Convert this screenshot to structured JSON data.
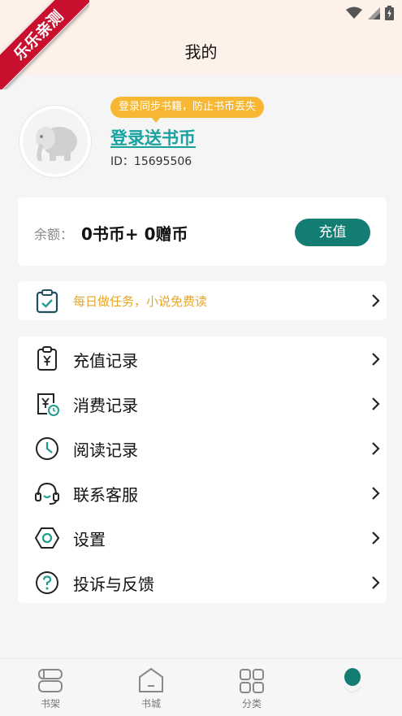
{
  "watermark": "乐乐亲测",
  "status_bar": {
    "icons": [
      "wifi-icon",
      "signal-icon",
      "battery-charging-icon"
    ]
  },
  "header": {
    "title": "我的"
  },
  "profile": {
    "tip": "登录同步书籍，防止书币丢失",
    "login_label": "登录送书币",
    "user_id": "ID：15695506",
    "avatar_icon": "elephant-icon"
  },
  "balance": {
    "label": "余额：",
    "value": "0书币+ 0赠币",
    "recharge_label": "充值"
  },
  "task": {
    "text": "每日做任务，小说免费读",
    "icon": "clipboard-check-icon"
  },
  "menu": [
    {
      "label": "充值记录",
      "icon": "recharge-record-icon"
    },
    {
      "label": "消费记录",
      "icon": "consume-record-icon"
    },
    {
      "label": "阅读记录",
      "icon": "clock-icon"
    },
    {
      "label": "联系客服",
      "icon": "headset-icon"
    },
    {
      "label": "设置",
      "icon": "settings-hex-icon"
    },
    {
      "label": "投诉与反馈",
      "icon": "question-icon"
    }
  ],
  "tabs": [
    {
      "label": "书架",
      "icon": "bookshelf-icon"
    },
    {
      "label": "书城",
      "icon": "bookstore-icon"
    },
    {
      "label": "分类",
      "icon": "category-grid-icon"
    },
    {
      "label": "",
      "icon": "profile-dot-icon"
    }
  ],
  "colors": {
    "accent": "#137d74",
    "link": "#17a2a0",
    "tip": "#f7b733",
    "task_text": "#e8a628",
    "header_bg": "#fdf1ea",
    "ribbon": "#c8102e"
  }
}
